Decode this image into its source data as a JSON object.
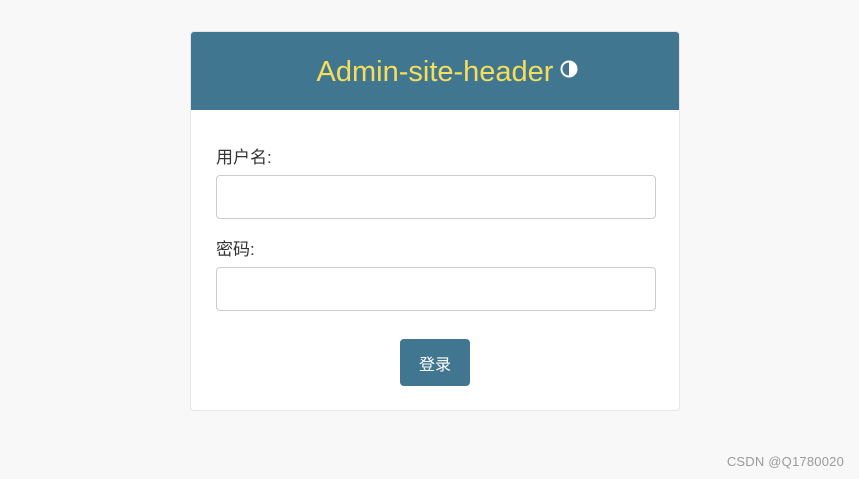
{
  "header": {
    "title": "Admin-site-header",
    "theme_toggle_icon": "half-circle-contrast-icon"
  },
  "form": {
    "username_label": "用户名:",
    "username_value": "",
    "password_label": "密码:",
    "password_value": "",
    "submit_label": "登录"
  },
  "watermark": "CSDN @Q1780020",
  "colors": {
    "header_bg": "#417690",
    "header_title": "#f5dd5d",
    "button_bg": "#417690",
    "page_bg": "#f8f8f8"
  }
}
